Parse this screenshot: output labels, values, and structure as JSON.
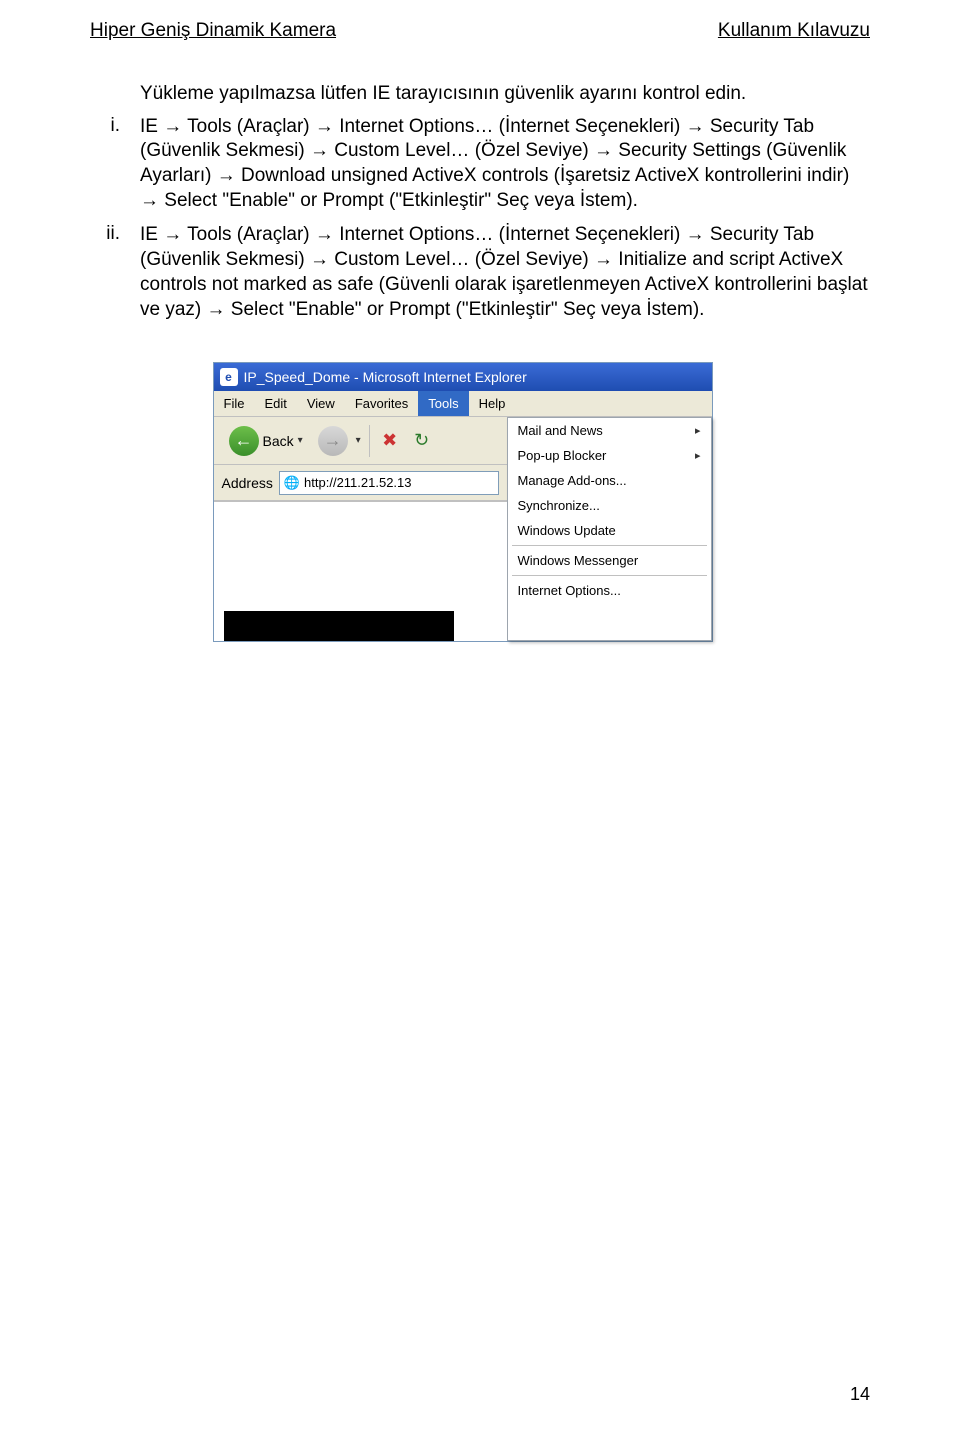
{
  "header": {
    "left": "Hiper Geniş Dinamik Kamera",
    "right": "Kullanım Kılavuzu"
  },
  "intro": "Yükleme yapılmazsa lütfen IE tarayıcısının güvenlik ayarını kontrol edin.",
  "items": [
    {
      "marker": "i.",
      "text": "IE → Tools (Araçlar) → Internet Options… (İnternet Seçenekleri) → Security Tab (Güvenlik Sekmesi) → Custom Level… (Özel Seviye) → Security Settings (Güvenlik Ayarları) → Download unsigned ActiveX controls (İşaretsiz ActiveX kontrollerini indir) → Select \"Enable\" or Prompt (\"Etkinleştir\" Seç veya İstem)."
    },
    {
      "marker": "ii.",
      "text": "IE → Tools (Araçlar) → Internet Options… (İnternet Seçenekleri) → Security Tab (Güvenlik Sekmesi) → Custom Level… (Özel Seviye) → Initialize and script ActiveX controls not marked as safe (Güvenli olarak işaretlenmeyen ActiveX kontrollerini başlat ve yaz) → Select \"Enable\" or Prompt (\"Etkinleştir\" Seç veya İstem)."
    }
  ],
  "ie": {
    "title": "IP_Speed_Dome - Microsoft Internet Explorer",
    "logo": "e",
    "menubar": [
      "File",
      "Edit",
      "View",
      "Favorites",
      "Tools",
      "Help"
    ],
    "toolbar": {
      "back": "Back",
      "back_arrow": "←",
      "fwd_arrow": "→",
      "stop": "✖",
      "refresh": "↻"
    },
    "address": {
      "label": "Address",
      "icon": "🌐",
      "url": "http://211.21.52.13"
    },
    "dropdown": [
      {
        "label": "Mail and News",
        "has_sub": true
      },
      {
        "label": "Pop-up Blocker",
        "has_sub": true
      },
      {
        "label": "Manage Add-ons...",
        "has_sub": false
      },
      {
        "label": "Synchronize...",
        "has_sub": false
      },
      {
        "label": "Windows Update",
        "has_sub": false
      },
      {
        "sep": true
      },
      {
        "label": "Windows Messenger",
        "has_sub": false
      },
      {
        "sep": true
      },
      {
        "label": "Internet Options...",
        "has_sub": false
      }
    ]
  },
  "page_number": "14"
}
